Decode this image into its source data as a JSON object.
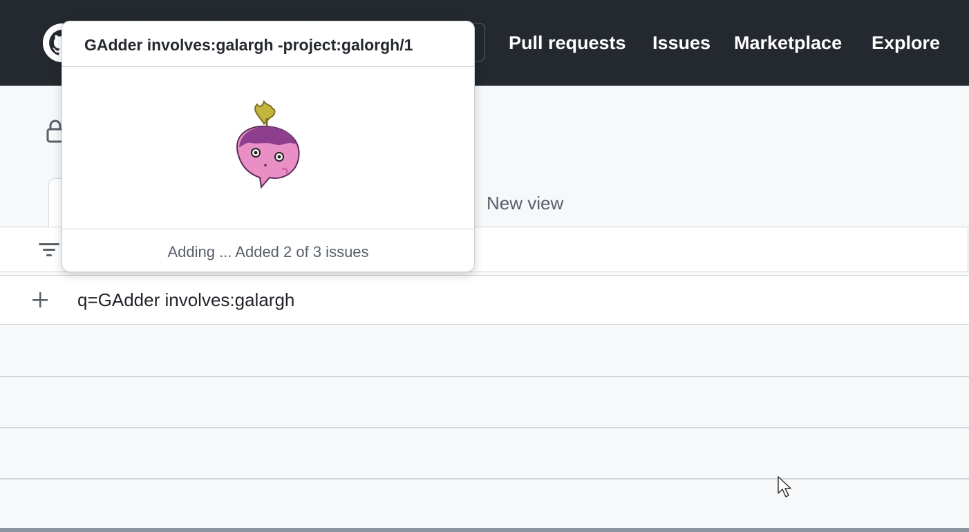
{
  "header": {
    "nav": [
      {
        "label": "Pull requests"
      },
      {
        "label": "Issues"
      },
      {
        "label": "Marketplace"
      },
      {
        "label": "Explore"
      }
    ]
  },
  "project": {
    "tabs": {
      "new_view_label": "New view"
    },
    "query_row": {
      "text": "q=GAdder involves:galargh"
    }
  },
  "popup": {
    "title": "GAdder involves:galargh -project:galorgh/1",
    "status": "Adding ... Added 2 of 3 issues",
    "progress": {
      "added": 2,
      "total": 3
    }
  },
  "colors": {
    "header_bg": "#24292f",
    "page_bg": "#f6f8fa",
    "mascot_purple": "#8e3e8f",
    "mascot_pink": "#e98fc6",
    "leaf_green": "#c2b63a"
  },
  "icons": [
    "github-logo-icon",
    "lock-icon",
    "filter-icon",
    "plus-icon",
    "cursor-arrow-icon"
  ]
}
